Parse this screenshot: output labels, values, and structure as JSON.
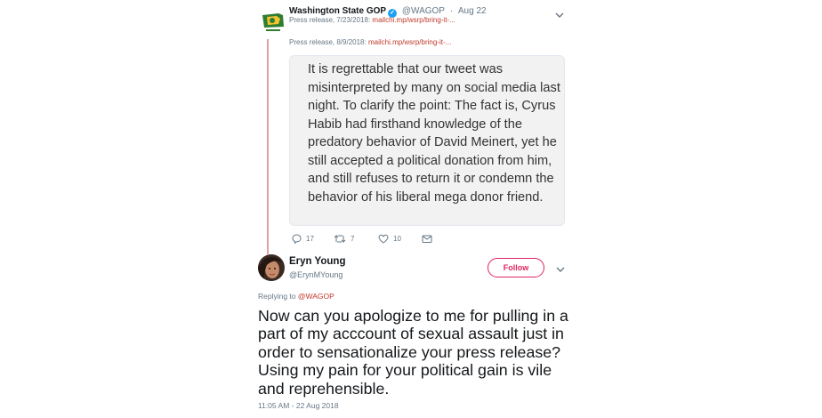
{
  "parent_tweet": {
    "author_name": "Washington State GOP",
    "handle": "@WAGOP",
    "separator": "·",
    "date": "Aug 22",
    "line1_prefix": "Press release, 7/23/2018:",
    "line1_link": "mailchi.mp/wsrp/bring-it-...",
    "line2_prefix": "Press release, 8/9/2018:",
    "line2_link": "mailchi.mp/wsrp/bring-it-...",
    "card_text": "It is regrettable that our tweet was misinterpreted by many on social media last night. To clarify the point: The fact is, Cyrus Habib had firsthand knowledge of the predatory behavior of David Meinert, yet he still accepted a political donation from him, and still refuses to return it or condemn the behavior of his liberal mega donor friend.",
    "actions": {
      "reply_count": "17",
      "retweet_count": "7",
      "like_count": "10"
    }
  },
  "reply_tweet": {
    "author_name": "Eryn Young",
    "handle": "@ErynMYoung",
    "follow_label": "Follow",
    "replying_prefix": "Replying to",
    "replying_to": "@WAGOP",
    "text": "Now can you apologize to me for pulling in a part of my acccount of sexual assault just in order to sensationalize your press release? Using my pain for your political gain is vile and reprehensible.",
    "timestamp": "11:05 AM - 22 Aug 2018"
  },
  "colors": {
    "link": "#c0392b",
    "follow": "#e0245e",
    "thread_line": "#e0a0a8",
    "verified": "#1da1f2"
  },
  "icons": [
    "wa-gop-logo-icon",
    "verified-icon",
    "chevron-down-icon",
    "reply-icon",
    "retweet-icon",
    "like-icon",
    "direct-message-icon",
    "avatar-photo"
  ]
}
